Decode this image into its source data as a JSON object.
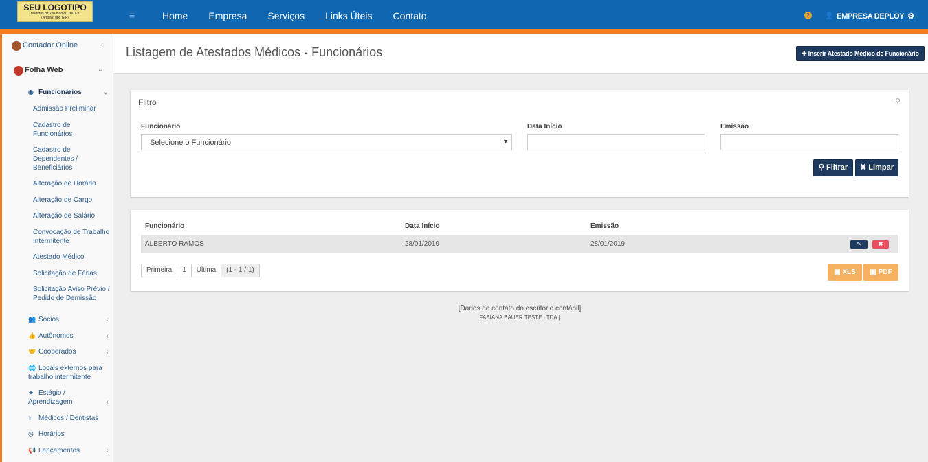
{
  "logo": {
    "title": "SEU LOGOTIPO",
    "line1": "Medidas de 250 x 68 ou 100 Kb",
    "line2": "(Arquivo tipo GIF)"
  },
  "nav": {
    "home": "Home",
    "empresa": "Empresa",
    "servicos": "Serviços",
    "links": "Links Úteis",
    "contato": "Contato"
  },
  "user": {
    "name": "EMPRESA DEPLOY"
  },
  "sidebar": {
    "contador": "Contador Online",
    "folha": "Folha Web",
    "funcionarios": "Funcionários",
    "sub": {
      "s1": "Admissão Preliminar",
      "s2": "Cadastro de Funcionários",
      "s3": "Cadastro de Dependentes / Beneficiários",
      "s4": "Alteração de Horário",
      "s5": "Alteração de Cargo",
      "s6": "Alteração de Salário",
      "s7": "Convocação de Trabalho Intermitente",
      "s8": "Atestado Médico",
      "s9": "Solicitação de Férias",
      "s10": "Solicitação Aviso Prévio / Pedido de Demissão"
    },
    "sec": {
      "socios": "Sócios",
      "autonomos": "Autônomos",
      "cooperados": "Cooperados",
      "locais": "Locais externos para trabalho intermitente",
      "estagio": "Estágio / Aprendizagem",
      "medicos": "Médicos / Dentistas",
      "horarios": "Horários",
      "lancamentos": "Lançamentos"
    }
  },
  "page": {
    "title": "Listagem de Atestados Médicos - Funcionários",
    "insert_label": "Inserir Atestado Médico de Funcionário"
  },
  "filter": {
    "title": "Filtro",
    "funcionario_label": "Funcionário",
    "funcionario_value": "Selecione o Funcionário",
    "data_inicio_label": "Data Início",
    "emissao_label": "Emissão",
    "filtrar": "Filtrar",
    "limpar": "Limpar"
  },
  "table": {
    "headers": [
      "Funcionário",
      "Data Início",
      "Emissão"
    ],
    "rows": [
      {
        "funcionario": "ALBERTO RAMOS",
        "data_inicio": "28/01/2019",
        "emissao": "28/01/2019"
      }
    ]
  },
  "pager": {
    "first": "Primeira",
    "page": "1",
    "last": "Última",
    "info": "(1 - 1 / 1)"
  },
  "export": {
    "xls": "XLS",
    "pdf": "PDF"
  },
  "footer": {
    "line1": "[Dados de contato do escritório contábil]",
    "line2": "FABIANA BAUER TESTE LTDA |"
  }
}
